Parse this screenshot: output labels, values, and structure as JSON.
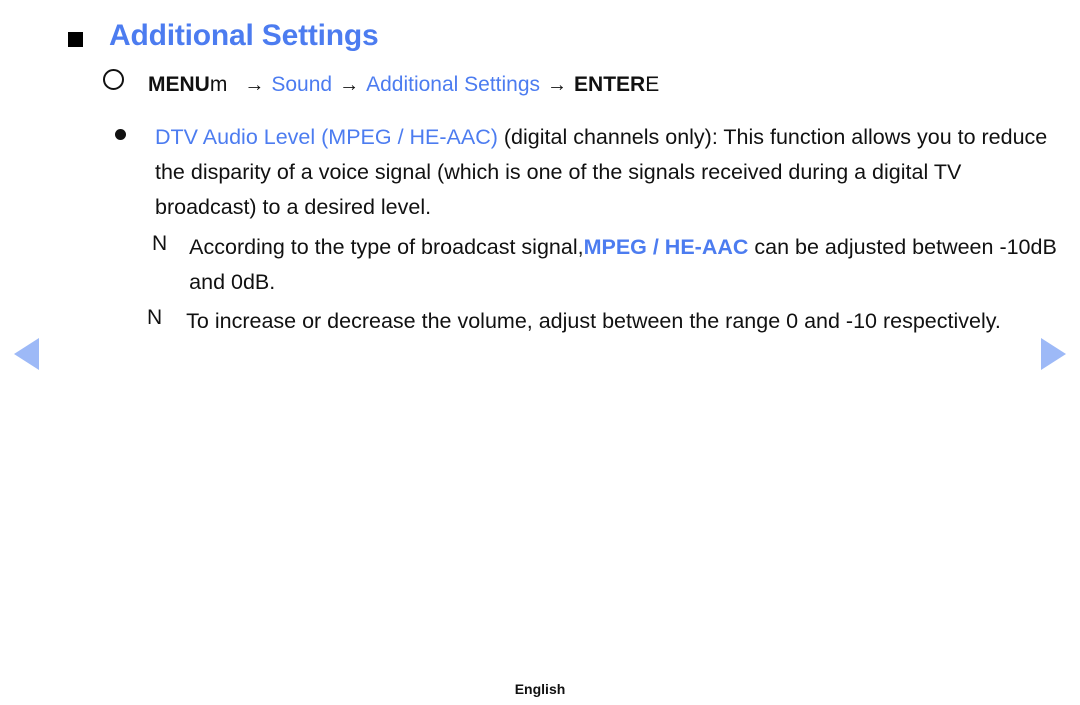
{
  "page": {
    "heading": "Additional Settings",
    "accent_color": "#4c7cf0",
    "arrow_color": "#9db9f7",
    "text_color": "#111111"
  },
  "menu_path": {
    "bullet_icon": "circle-outline-icon",
    "menu_label": "MENU",
    "menu_key_glyph": "m",
    "arrow_1": "→",
    "step_sound": "Sound",
    "arrow_2": "→",
    "step_additional_settings": "Additional Settings",
    "arrow_3": "→",
    "enter_label": "ENTER",
    "enter_key_glyph": "E"
  },
  "items": [
    {
      "bullet_icon": "filled-dot-icon",
      "term": "DTV Audio Level (MPEG / HE-AAC)",
      "body_before": " (digital channels only): This function allows you to reduce the disparity of a voice signal (which is one of the signals received during a digital TV broadcast) to a desired level."
    },
    {
      "bullet_icon": "note-n-icon",
      "bullet_glyph": "N",
      "text_part_1": "According to the type of broadcast signal,",
      "highlight": "MPEG / HE-AAC",
      "text_part_2": " can be adjusted between -10dB and 0dB."
    },
    {
      "bullet_icon": "note-n-icon",
      "bullet_glyph": "N",
      "text_part_1": "To increase or decrease the volume, adjust between the range 0 and -10 respectively.",
      "highlight": "",
      "text_part_2": ""
    }
  ],
  "navigation": {
    "prev_icon": "triangle-left-icon",
    "next_icon": "triangle-right-icon"
  },
  "footer": {
    "language": "English"
  }
}
